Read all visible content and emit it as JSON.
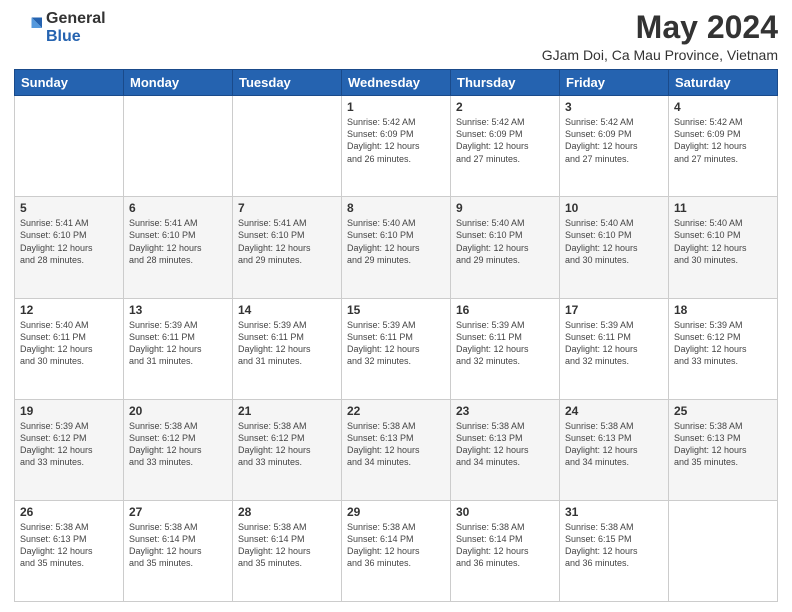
{
  "header": {
    "logo_general": "General",
    "logo_blue": "Blue",
    "month_title": "May 2024",
    "location": "GJam Doi, Ca Mau Province, Vietnam"
  },
  "days_of_week": [
    "Sunday",
    "Monday",
    "Tuesday",
    "Wednesday",
    "Thursday",
    "Friday",
    "Saturday"
  ],
  "weeks": [
    [
      {
        "day": "",
        "info": ""
      },
      {
        "day": "",
        "info": ""
      },
      {
        "day": "",
        "info": ""
      },
      {
        "day": "1",
        "info": "Sunrise: 5:42 AM\nSunset: 6:09 PM\nDaylight: 12 hours\nand 26 minutes."
      },
      {
        "day": "2",
        "info": "Sunrise: 5:42 AM\nSunset: 6:09 PM\nDaylight: 12 hours\nand 27 minutes."
      },
      {
        "day": "3",
        "info": "Sunrise: 5:42 AM\nSunset: 6:09 PM\nDaylight: 12 hours\nand 27 minutes."
      },
      {
        "day": "4",
        "info": "Sunrise: 5:42 AM\nSunset: 6:09 PM\nDaylight: 12 hours\nand 27 minutes."
      }
    ],
    [
      {
        "day": "5",
        "info": "Sunrise: 5:41 AM\nSunset: 6:10 PM\nDaylight: 12 hours\nand 28 minutes."
      },
      {
        "day": "6",
        "info": "Sunrise: 5:41 AM\nSunset: 6:10 PM\nDaylight: 12 hours\nand 28 minutes."
      },
      {
        "day": "7",
        "info": "Sunrise: 5:41 AM\nSunset: 6:10 PM\nDaylight: 12 hours\nand 29 minutes."
      },
      {
        "day": "8",
        "info": "Sunrise: 5:40 AM\nSunset: 6:10 PM\nDaylight: 12 hours\nand 29 minutes."
      },
      {
        "day": "9",
        "info": "Sunrise: 5:40 AM\nSunset: 6:10 PM\nDaylight: 12 hours\nand 29 minutes."
      },
      {
        "day": "10",
        "info": "Sunrise: 5:40 AM\nSunset: 6:10 PM\nDaylight: 12 hours\nand 30 minutes."
      },
      {
        "day": "11",
        "info": "Sunrise: 5:40 AM\nSunset: 6:10 PM\nDaylight: 12 hours\nand 30 minutes."
      }
    ],
    [
      {
        "day": "12",
        "info": "Sunrise: 5:40 AM\nSunset: 6:11 PM\nDaylight: 12 hours\nand 30 minutes."
      },
      {
        "day": "13",
        "info": "Sunrise: 5:39 AM\nSunset: 6:11 PM\nDaylight: 12 hours\nand 31 minutes."
      },
      {
        "day": "14",
        "info": "Sunrise: 5:39 AM\nSunset: 6:11 PM\nDaylight: 12 hours\nand 31 minutes."
      },
      {
        "day": "15",
        "info": "Sunrise: 5:39 AM\nSunset: 6:11 PM\nDaylight: 12 hours\nand 32 minutes."
      },
      {
        "day": "16",
        "info": "Sunrise: 5:39 AM\nSunset: 6:11 PM\nDaylight: 12 hours\nand 32 minutes."
      },
      {
        "day": "17",
        "info": "Sunrise: 5:39 AM\nSunset: 6:11 PM\nDaylight: 12 hours\nand 32 minutes."
      },
      {
        "day": "18",
        "info": "Sunrise: 5:39 AM\nSunset: 6:12 PM\nDaylight: 12 hours\nand 33 minutes."
      }
    ],
    [
      {
        "day": "19",
        "info": "Sunrise: 5:39 AM\nSunset: 6:12 PM\nDaylight: 12 hours\nand 33 minutes."
      },
      {
        "day": "20",
        "info": "Sunrise: 5:38 AM\nSunset: 6:12 PM\nDaylight: 12 hours\nand 33 minutes."
      },
      {
        "day": "21",
        "info": "Sunrise: 5:38 AM\nSunset: 6:12 PM\nDaylight: 12 hours\nand 33 minutes."
      },
      {
        "day": "22",
        "info": "Sunrise: 5:38 AM\nSunset: 6:13 PM\nDaylight: 12 hours\nand 34 minutes."
      },
      {
        "day": "23",
        "info": "Sunrise: 5:38 AM\nSunset: 6:13 PM\nDaylight: 12 hours\nand 34 minutes."
      },
      {
        "day": "24",
        "info": "Sunrise: 5:38 AM\nSunset: 6:13 PM\nDaylight: 12 hours\nand 34 minutes."
      },
      {
        "day": "25",
        "info": "Sunrise: 5:38 AM\nSunset: 6:13 PM\nDaylight: 12 hours\nand 35 minutes."
      }
    ],
    [
      {
        "day": "26",
        "info": "Sunrise: 5:38 AM\nSunset: 6:13 PM\nDaylight: 12 hours\nand 35 minutes."
      },
      {
        "day": "27",
        "info": "Sunrise: 5:38 AM\nSunset: 6:14 PM\nDaylight: 12 hours\nand 35 minutes."
      },
      {
        "day": "28",
        "info": "Sunrise: 5:38 AM\nSunset: 6:14 PM\nDaylight: 12 hours\nand 35 minutes."
      },
      {
        "day": "29",
        "info": "Sunrise: 5:38 AM\nSunset: 6:14 PM\nDaylight: 12 hours\nand 36 minutes."
      },
      {
        "day": "30",
        "info": "Sunrise: 5:38 AM\nSunset: 6:14 PM\nDaylight: 12 hours\nand 36 minutes."
      },
      {
        "day": "31",
        "info": "Sunrise: 5:38 AM\nSunset: 6:15 PM\nDaylight: 12 hours\nand 36 minutes."
      },
      {
        "day": "",
        "info": ""
      }
    ]
  ]
}
